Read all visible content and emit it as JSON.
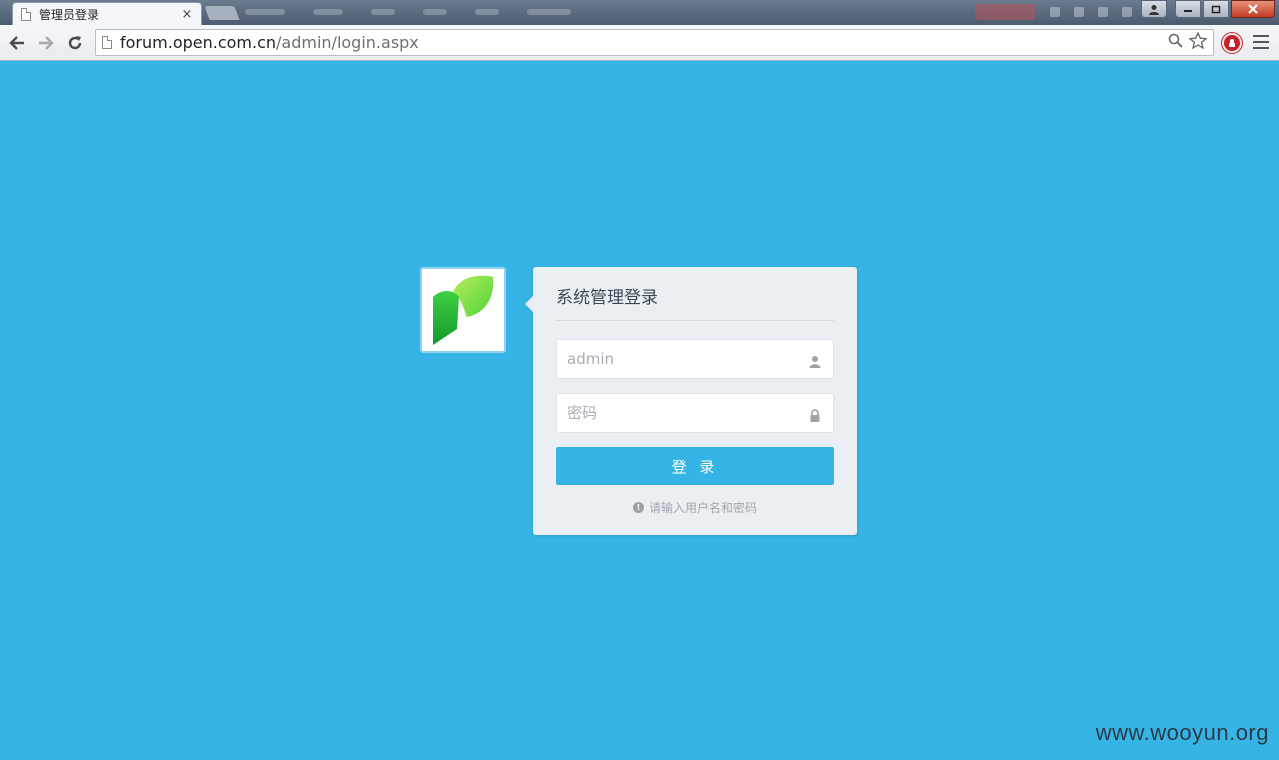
{
  "browser": {
    "tab_title": "管理员登录",
    "tab_close": "×",
    "url_host": "forum.open.com.cn",
    "url_path": "/admin/login.aspx",
    "back_icon": "arrow-left-icon",
    "forward_icon": "arrow-right-icon",
    "reload_icon": "reload-icon",
    "zoom_icon": "magnifier-icon",
    "bookmark_icon": "star-icon",
    "extension_icon": "adblock-icon",
    "menu_icon": "hamburger-menu-icon"
  },
  "login": {
    "title": "系统管理登录",
    "username_value": "admin",
    "username_placeholder": "admin",
    "password_placeholder": "密码",
    "submit_label": "登 录",
    "hint": "请输入用户名和密码"
  },
  "watermark": "www.wooyun.org",
  "colors": {
    "page_background": "#36b4e5",
    "card_background": "#ebeef2",
    "button": "#36b4e5",
    "logo_green_light": "#8ee04a",
    "logo_green_dark": "#1fb83a"
  }
}
